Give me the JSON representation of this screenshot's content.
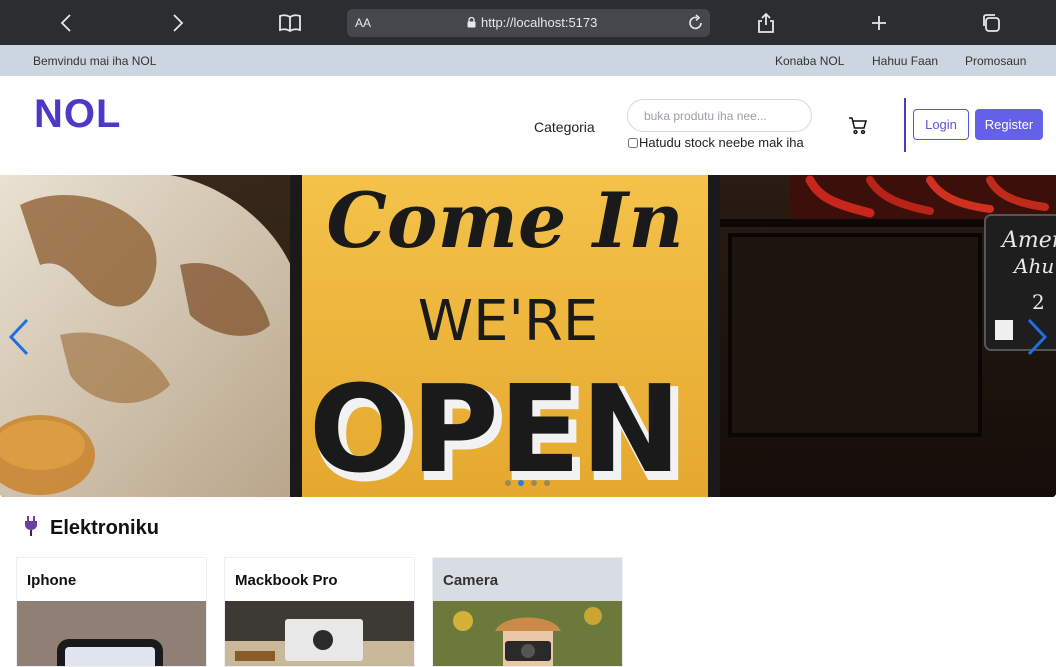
{
  "browser": {
    "url": "http://localhost:5173",
    "text_size_label": "AA"
  },
  "topbar": {
    "welcome": "Bemvindu mai iha NOL",
    "links": [
      "Konaba NOL",
      "Hahuu Faan",
      "Promosaun"
    ]
  },
  "header": {
    "logo": "NOL",
    "category_label": "Categoria",
    "search_placeholder": "buka produtu iha nee...",
    "stock_filter_label": "Hatudu stock neebe mak iha",
    "login_label": "Login",
    "register_label": "Register"
  },
  "carousel": {
    "sign_line1": "Come In",
    "sign_line2": "WE'RE",
    "sign_line3": "OPEN",
    "side_board_line1": "Amer",
    "side_board_line2": "Ahu",
    "side_board_line3": "2",
    "slide_count": 4,
    "active_slide": 2
  },
  "section": {
    "title": "Elektroniku",
    "icon": "plug-icon"
  },
  "products": [
    {
      "name": "Iphone"
    },
    {
      "name": "Mackbook Pro"
    },
    {
      "name": "Camera"
    }
  ]
}
